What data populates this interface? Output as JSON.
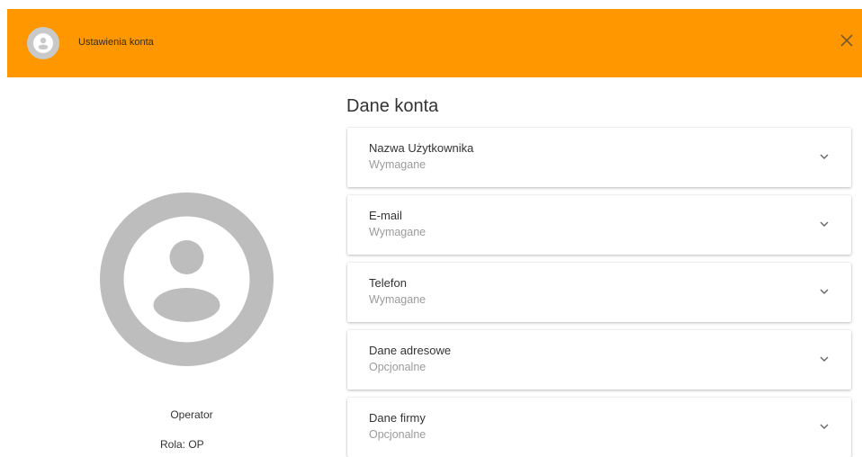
{
  "header": {
    "title": "Ustawienia konta",
    "avatar_icon": "account-circle-icon",
    "close_icon": "close-icon",
    "background_color": "#ff9800"
  },
  "profile": {
    "avatar_icon": "account-circle-icon",
    "name": "Operator",
    "role": "Rola: OP"
  },
  "section": {
    "title": "Dane konta"
  },
  "panels": [
    {
      "label": "Nazwa Użytkownika",
      "status": "Wymagane",
      "icon": "chevron-down-icon"
    },
    {
      "label": "E-mail",
      "status": "Wymagane",
      "icon": "chevron-down-icon"
    },
    {
      "label": "Telefon",
      "status": "Wymagane",
      "icon": "chevron-down-icon"
    },
    {
      "label": "Dane adresowe",
      "status": "Opcjonalne",
      "icon": "chevron-down-icon"
    },
    {
      "label": "Dane firmy",
      "status": "Opcjonalne",
      "icon": "chevron-down-icon"
    }
  ]
}
